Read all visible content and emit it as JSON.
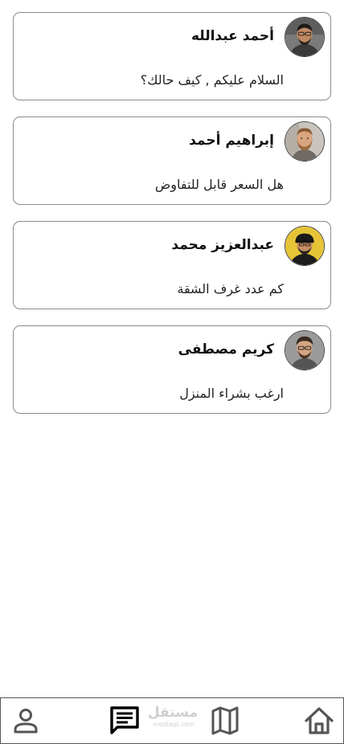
{
  "chats": [
    {
      "name": "أحمد عبدالله",
      "message": "السلام عليكم , كيف حالك؟",
      "avatar": "avatar-glasses-man"
    },
    {
      "name": "إبراهيم أحمد",
      "message": "هل السعر قابل للتفاوض",
      "avatar": "avatar-bearded-man"
    },
    {
      "name": "عبدالعزيز محمد",
      "message": "كم عدد غرف الشقة",
      "avatar": "avatar-cap-man"
    },
    {
      "name": "كريم مصطفى",
      "message": "ارغب بشراء المنزل",
      "avatar": "avatar-young-man"
    }
  ],
  "watermark": {
    "arabic": "مستقل",
    "latin": "mostaql.com"
  },
  "nav": {
    "items": [
      "person-icon",
      "chat-icon",
      "map-icon",
      "home-icon"
    ],
    "active": "chat-icon"
  },
  "colors": {
    "border": "#8a8a8a",
    "text": "#111111",
    "icon_inactive": "#555555",
    "icon_active": "#000000",
    "watermark": "#cfcfcf"
  }
}
